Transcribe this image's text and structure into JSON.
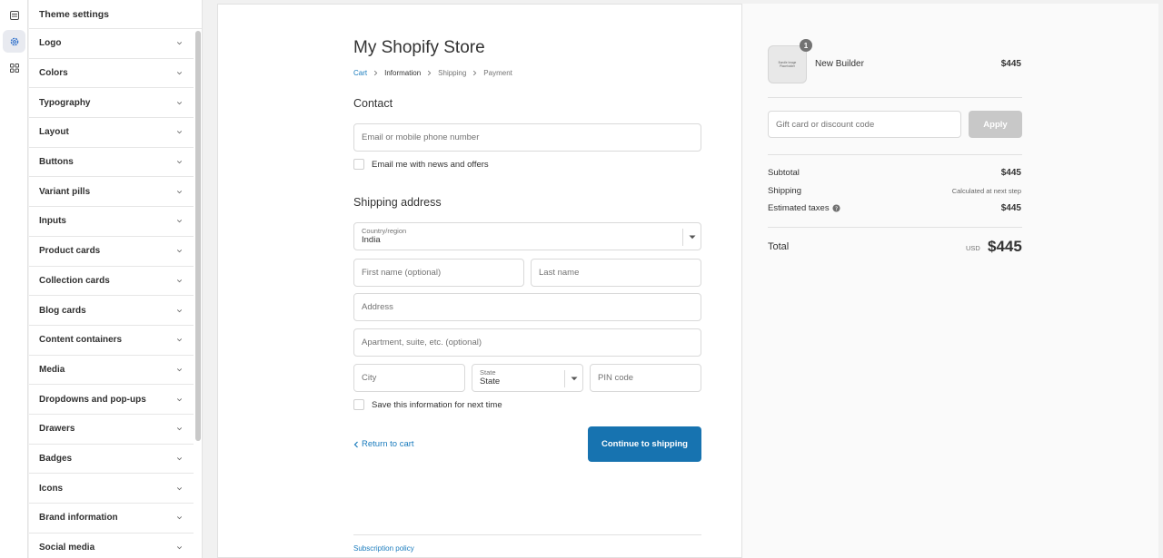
{
  "rail": {
    "icons": [
      "sections-icon",
      "gear-icon",
      "apps-icon"
    ],
    "active": "gear-icon"
  },
  "sidebar": {
    "title": "Theme settings",
    "items": [
      {
        "label": "Logo"
      },
      {
        "label": "Colors"
      },
      {
        "label": "Typography"
      },
      {
        "label": "Layout"
      },
      {
        "label": "Buttons"
      },
      {
        "label": "Variant pills"
      },
      {
        "label": "Inputs"
      },
      {
        "label": "Product cards"
      },
      {
        "label": "Collection cards"
      },
      {
        "label": "Blog cards"
      },
      {
        "label": "Content containers"
      },
      {
        "label": "Media"
      },
      {
        "label": "Dropdowns and pop-ups"
      },
      {
        "label": "Drawers"
      },
      {
        "label": "Badges"
      },
      {
        "label": "Icons"
      },
      {
        "label": "Brand information"
      },
      {
        "label": "Social media"
      }
    ]
  },
  "checkout": {
    "store_name": "My Shopify Store",
    "breadcrumb": {
      "cart": "Cart",
      "information": "Information",
      "shipping": "Shipping",
      "payment": "Payment"
    },
    "contact": {
      "heading": "Contact",
      "email_placeholder": "Email or mobile phone number",
      "newsletter_label": "Email me with news and offers"
    },
    "shipping": {
      "heading": "Shipping address",
      "country_label": "Country/region",
      "country_value": "India",
      "first_name_placeholder": "First name (optional)",
      "last_name_placeholder": "Last name",
      "address_placeholder": "Address",
      "apartment_placeholder": "Apartment, suite, etc. (optional)",
      "city_placeholder": "City",
      "state_label": "State",
      "state_value": "State",
      "pin_placeholder": "PIN code",
      "save_info_label": "Save this information for next time"
    },
    "return_link": "Return to cart",
    "continue_button": "Continue to shipping",
    "footer_link": "Subscription policy"
  },
  "order": {
    "item": {
      "thumb_text": "Bundle Image Placeholder",
      "quantity": "1",
      "name": "New Builder",
      "price": "$445"
    },
    "discount_placeholder": "Gift card or discount code",
    "apply_button": "Apply",
    "subtotal_label": "Subtotal",
    "subtotal_value": "$445",
    "shipping_label": "Shipping",
    "shipping_value": "Calculated at next step",
    "taxes_label": "Estimated taxes",
    "taxes_value": "$445",
    "total_label": "Total",
    "currency": "USD",
    "total_value": "$445"
  },
  "colors": {
    "link": "#197bbd",
    "primary_button": "#1773b0",
    "apply_button_disabled": "#c8c8c8"
  }
}
